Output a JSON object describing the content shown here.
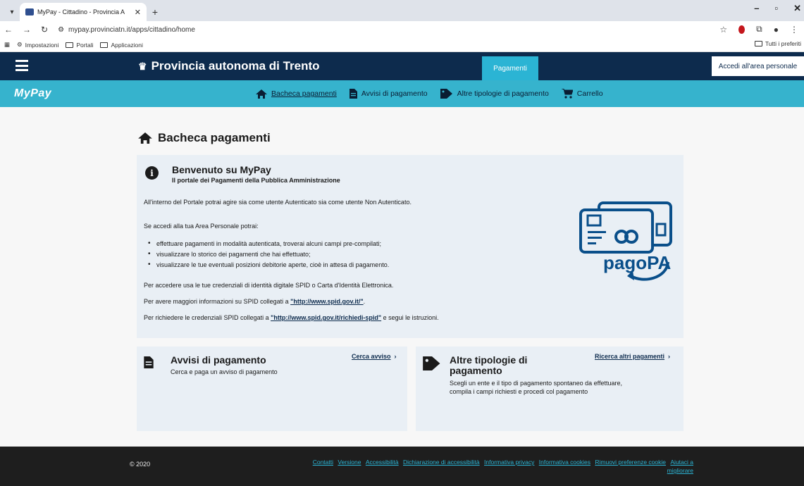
{
  "browser": {
    "tab_title": "MyPay - Cittadino - Provincia A",
    "tab_close": "✕",
    "new_tab": "+",
    "url": "mypay.provinciatn.it/apps/cittadino/home",
    "bookmarks": [
      "Impostazioni",
      "Portali",
      "Applicazioni"
    ],
    "bookmarks_right": "Tutti i preferiti"
  },
  "header": {
    "title": "Provincia autonoma di Trento",
    "nav_active": "Pagamenti",
    "login_button": "Accedi all'area personale"
  },
  "subnav": {
    "logo": "MyPay",
    "items": [
      {
        "label": "Bacheca pagamenti",
        "icon": "home-icon",
        "active": true
      },
      {
        "label": "Avvisi di pagamento",
        "icon": "document-icon",
        "active": false
      },
      {
        "label": "Altre tipologie di pagamento",
        "icon": "tag-icon",
        "active": false
      },
      {
        "label": "Carrello",
        "icon": "cart-icon",
        "active": false
      }
    ]
  },
  "main": {
    "page_title": "Bacheca pagamenti",
    "welcome": {
      "title": "Benvenuto su MyPay",
      "subtitle": "Il portale dei Pagamenti della Pubblica Amministrazione",
      "intro": "All'interno del Portale potrai agire sia come utente Autenticato sia come utente Non Autenticato.",
      "area_intro": "Se accedi alla tua Area Personale potrai:",
      "bullets": [
        "effettuare pagamenti in modalità autenticata, troverai alcuni campi pre-compilati;",
        "visualizzare lo storico dei pagamenti che hai effettuato;",
        "visualizzare le tue eventuali posizioni debitorie aperte, cioè in attesa di pagamento."
      ],
      "spid_text": "Per accedere usa le tue credenziali di identità digitale SPID o Carta d'Identità Elettronica.",
      "info_prefix": "Per avere maggiori informazioni su SPID collegati a ",
      "info_link": "\"http://www.spid.gov.it/\"",
      "info_suffix": ".",
      "cred_prefix": "Per richiedere le credenziali SPID collegati a ",
      "cred_link": "\"http://www.spid.gov.it/richiedi-spid\"",
      "cred_suffix": " e segui le istruzioni.",
      "logo_text": "pagoPA"
    },
    "cards": [
      {
        "title": "Avvisi di pagamento",
        "desc": "Cerca e paga un avviso di pagamento",
        "link": "Cerca avviso",
        "arrow": "›"
      },
      {
        "title": "Altre tipologie di pagamento",
        "desc1": "Scegli un ente e il tipo di pagamento spontaneo da effettuare,",
        "desc2": "compila i campi richiesti e procedi col pagamento",
        "link": "Ricerca altri pagamenti",
        "arrow": "›"
      }
    ]
  },
  "footer": {
    "copyright": "© 2020",
    "links": [
      "Contatti",
      "Versione",
      "Accessibilità",
      "Dichiarazione di accessibilità",
      "Informativa privacy",
      "Informativa cookies",
      "Rimuovi preferenze cookie",
      "Aiutaci a migliorare"
    ]
  },
  "colors": {
    "header_bg": "#0d2b4d",
    "accent": "#2bb4d4",
    "subnav_bg": "#36b3cd",
    "card_bg": "#e9eff5",
    "footer_bg": "#1e1e1e"
  }
}
